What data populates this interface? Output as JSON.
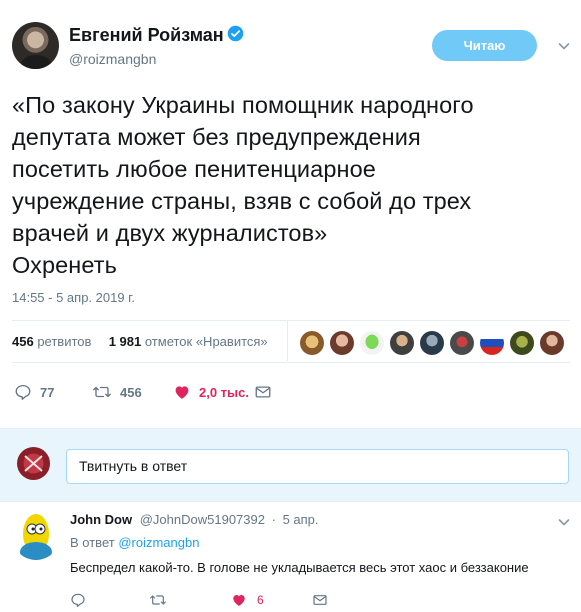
{
  "tweet": {
    "author_name": "Евгений Ройзман",
    "author_handle": "@roizmangbn",
    "follow_label": "Читаю",
    "text_lines": [
      "«По закону Украины помощник народного",
      "депутата может без предупреждения",
      "посетить любое пенитенциарное",
      "учреждение страны, взяв с собой до трех",
      "врачей и двух журналистов»",
      "Охренеть"
    ],
    "timestamp": "14:55 - 5 апр. 2019 г.",
    "retweets_count": "456",
    "retweets_label": "ретвитов",
    "likes_count": "1 981",
    "likes_label": "отметок «Нравится»",
    "actions": {
      "replies": "77",
      "retweets": "456",
      "likes": "2,0 тыс."
    }
  },
  "reply_box": {
    "placeholder": "Твитнуть в ответ"
  },
  "reply": {
    "author_name": "John Dow",
    "author_handle": "@JohnDow51907392",
    "separator": "·",
    "date": "5 апр.",
    "in_reply_prefix": "В ответ",
    "in_reply_to": "@roizmangbn",
    "text": "Беспредел какой-то. В голове не укладывается весь этот хаос и беззаконие",
    "likes": "6"
  },
  "colors": {
    "accent": "#1da1f2",
    "follow_button": "#71c9f8",
    "like": "#e0245e",
    "muted": "#657786"
  }
}
